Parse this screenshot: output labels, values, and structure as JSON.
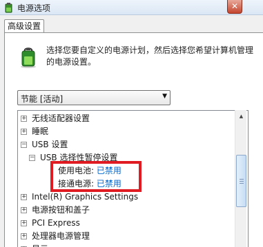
{
  "window": {
    "title": "电源选项",
    "close_label": "✕",
    "power_icon": "battery-power-icon"
  },
  "tabs": [
    {
      "label": "高级设置"
    }
  ],
  "description": {
    "line1": "选择您要自定义的电源计划，然后选择您希望计算机管理",
    "line2": "的电源设置。"
  },
  "plan_select": {
    "value": "节能 [活动]"
  },
  "tree": {
    "items": [
      {
        "label": "无线适配器设置",
        "expander": "+"
      },
      {
        "label": "睡眠",
        "expander": "+"
      },
      {
        "label": "USB 设置",
        "expander": "−"
      },
      {
        "label": "USB 选择性暂停设置",
        "expander": "−"
      },
      {
        "label": "使用电池:",
        "value": "已禁用"
      },
      {
        "label": "接通电源:",
        "value": "已禁用"
      },
      {
        "label": "Intel(R) Graphics Settings",
        "expander": "+"
      },
      {
        "label": "电源按钮和盖子",
        "expander": "+"
      },
      {
        "label": "PCI Express",
        "expander": "+"
      },
      {
        "label": "处理器电源管理",
        "expander": "+"
      },
      {
        "label": "显示",
        "expander": "+"
      }
    ]
  },
  "colors": {
    "highlight": "#e11b22",
    "value_text": "#0066cc"
  }
}
